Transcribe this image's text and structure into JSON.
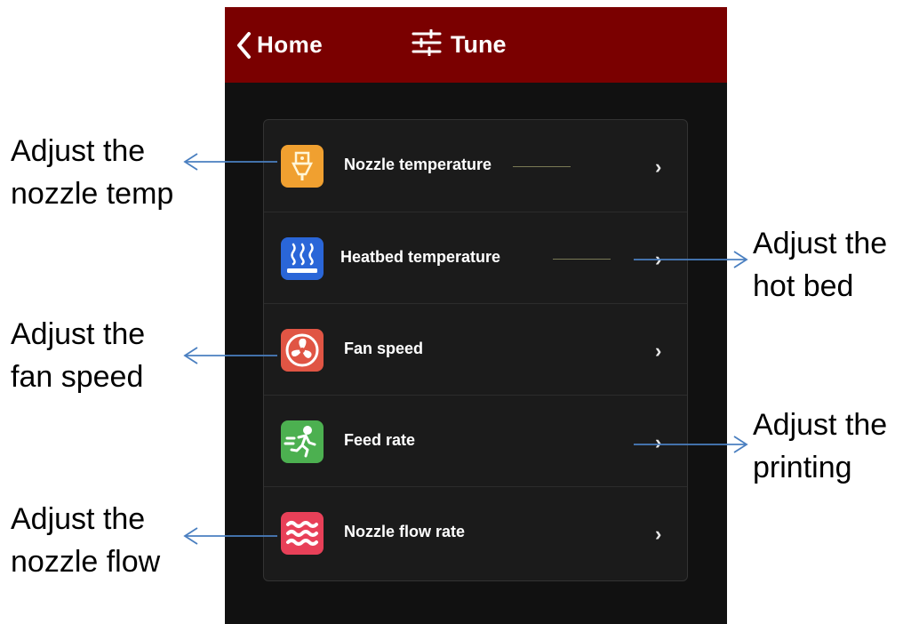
{
  "header": {
    "back_label": "Home",
    "title": "Tune",
    "background": "#7a0000"
  },
  "menu": {
    "items": [
      {
        "label": "Nozzle temperature",
        "icon": "nozzle-temperature-icon",
        "icon_color": "#f0a030"
      },
      {
        "label": "Heatbed temperature",
        "icon": "heatbed-temperature-icon",
        "icon_color": "#2a66d8"
      },
      {
        "label": "Fan speed",
        "icon": "fan-icon",
        "icon_color": "#e05544"
      },
      {
        "label": "Feed rate",
        "icon": "feed-rate-icon",
        "icon_color": "#4cb050"
      },
      {
        "label": "Nozzle flow rate",
        "icon": "flow-rate-icon",
        "icon_color": "#e84058"
      }
    ],
    "chevron": "›"
  },
  "annotations": {
    "nozzle_temp": {
      "line1": "Adjust the",
      "line2": "nozzle temp"
    },
    "hot_bed": {
      "line1": "Adjust the",
      "line2": "hot bed"
    },
    "fan_speed": {
      "line1": "Adjust the",
      "line2": "fan speed"
    },
    "printing": {
      "line1": "Adjust the",
      "line2": "printing"
    },
    "nozzle_flow": {
      "line1": "Adjust the",
      "line2": "nozzle flow"
    },
    "arrow_color": "#4a7fc0"
  }
}
